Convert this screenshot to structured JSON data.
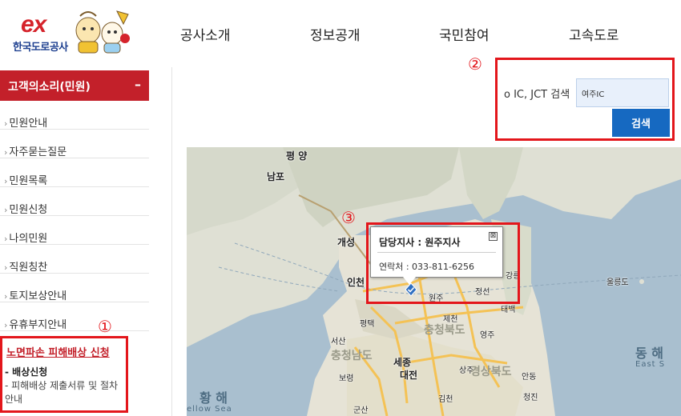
{
  "header": {
    "logo_text": "ex",
    "company_name": "한국도로공사",
    "nav": [
      "공사소개",
      "정보공개",
      "국민참여",
      "고속도로"
    ]
  },
  "sidebar": {
    "title": "고객의소리(민원)",
    "toggle": "–",
    "items": [
      "민원안내",
      "자주묻는질문",
      "민원목록",
      "민원신청",
      "나의민원",
      "직원칭찬",
      "토지보상안내",
      "유휴부지안내"
    ],
    "active_item": "노면파손 피해배상 신청",
    "sub_items": [
      "- 배상신청",
      "- 피해배상 제출서류 및 절차 안내"
    ]
  },
  "annotations": [
    "①",
    "②",
    "③"
  ],
  "search": {
    "label": "o IC, JCT 검색",
    "value": "여주IC",
    "button": "검색"
  },
  "popup": {
    "title": "담당지사 : 원주지사",
    "close": "⊠",
    "phone": "연락처 : 033-811-6256"
  },
  "map": {
    "cities": [
      "평 양",
      "남포",
      "개성",
      "인천",
      "원주",
      "정선",
      "강릉",
      "태백",
      "평택",
      "제천",
      "영주",
      "서산",
      "세종",
      "대전",
      "상주",
      "보령",
      "안동",
      "군산",
      "김천",
      "청진"
    ],
    "regions": [
      "충청남도",
      "충청북도",
      "경상북도"
    ],
    "sea_labels": [
      "황 해",
      "ellow Sea",
      "동 해",
      "East S",
      "울릉도"
    ],
    "colors": {
      "sea": "#a9bfcf",
      "land": "#e6e3d6",
      "road": "#f4c255"
    }
  }
}
